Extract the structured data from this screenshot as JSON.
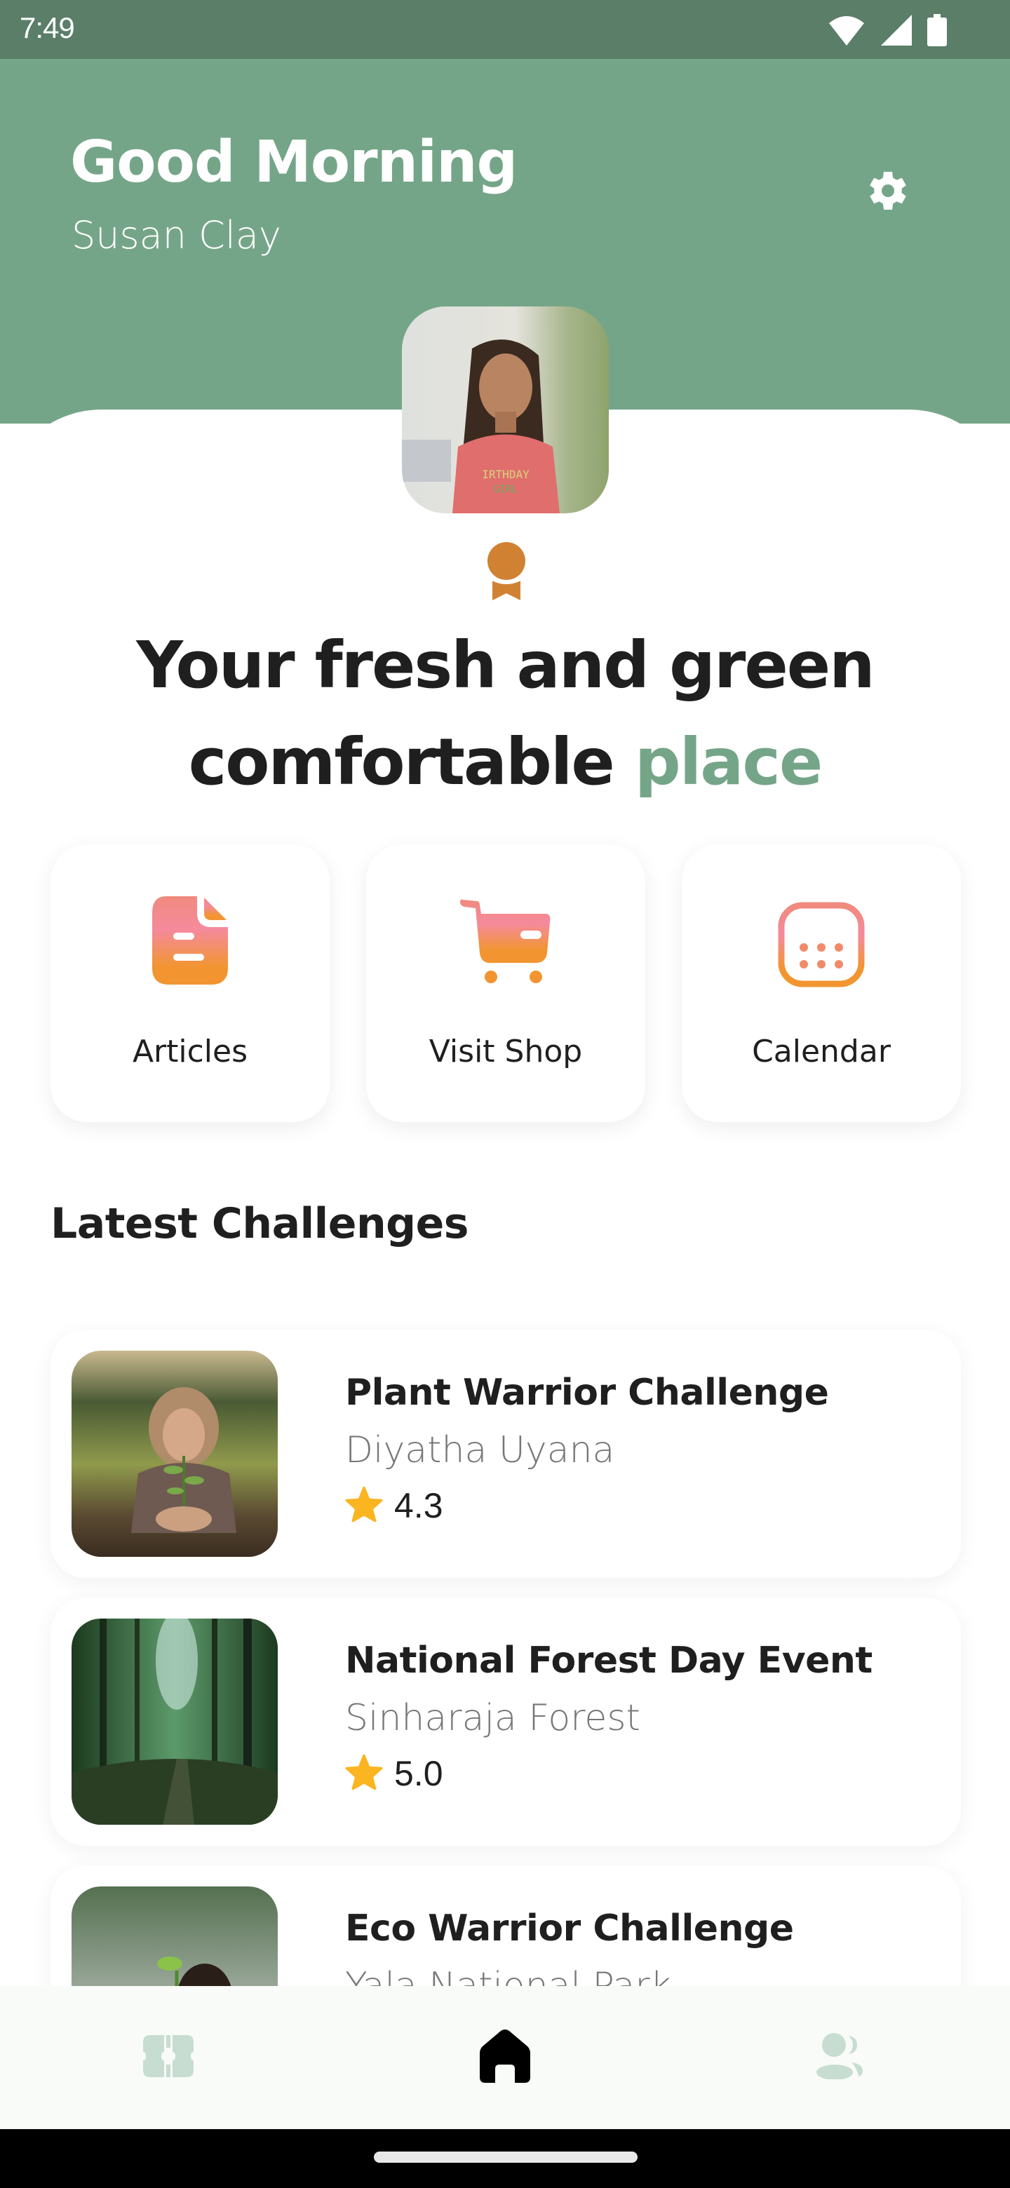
{
  "status_bar": {
    "time": "7:49",
    "icons": [
      "wifi-icon",
      "cellular-signal-icon",
      "battery-icon"
    ]
  },
  "header": {
    "greeting": "Good Morning",
    "user_name": "Susan Clay",
    "settings_icon": "gear-icon"
  },
  "profile": {
    "avatar_alt": "Profile photo of a girl in a pink 'Birthday Girl' t-shirt",
    "badge_icon": "award-ribbon-icon"
  },
  "headline": {
    "line1": "Your fresh and green",
    "line2_prefix": "comfortable ",
    "line2_accent": "place"
  },
  "quick_actions": [
    {
      "label": "Articles",
      "icon": "document-icon"
    },
    {
      "label": "Visit Shop",
      "icon": "shopping-cart-icon"
    },
    {
      "label": "Calendar",
      "icon": "calendar-icon"
    }
  ],
  "challenges_section": {
    "title": "Latest Challenges",
    "items": [
      {
        "title": "Plant Warrior Challenge",
        "location": "Diyatha Uyana",
        "rating": "4.3",
        "image_alt": "Child planting a seedling in a field"
      },
      {
        "title": "National Forest Day Event",
        "location": "Sinharaja Forest",
        "rating": "5.0",
        "image_alt": "Path through a dense green forest"
      },
      {
        "title": "Eco Warrior Challenge",
        "location": "Yala National Park",
        "rating": "",
        "image_alt": "Children planting a tree"
      }
    ]
  },
  "bottom_nav": {
    "items": [
      {
        "name": "dashboard",
        "icon": "dashboard-icon",
        "active": false
      },
      {
        "name": "home",
        "icon": "home-icon",
        "active": true
      },
      {
        "name": "community",
        "icon": "users-icon",
        "active": false
      }
    ]
  },
  "colors": {
    "status_bar": "#5a7e68",
    "brand_green": "#75a588",
    "accent_gradient_top": "#f08a7e",
    "accent_gradient_mid": "#f48a9c",
    "accent_gradient_bottom": "#f29530",
    "badge_orange": "#d08232",
    "star_yellow": "#fbb521",
    "nav_inactive": "#c8ddd1",
    "nav_active": "#000000"
  }
}
